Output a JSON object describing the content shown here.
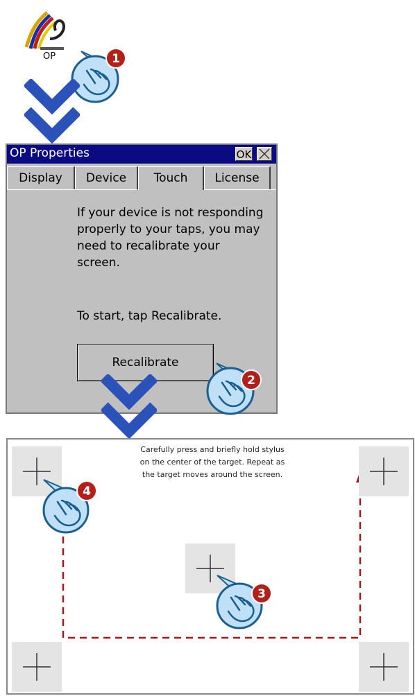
{
  "desktop": {
    "icon_name": "op-properties-icon",
    "icon_label": "OP"
  },
  "dialog": {
    "title": "OP Properties",
    "ok_label": "OK",
    "tabs": [
      {
        "label": "Display",
        "active": false
      },
      {
        "label": "Device",
        "active": false
      },
      {
        "label": "Touch",
        "active": true
      },
      {
        "label": "License",
        "active": false
      }
    ],
    "touch": {
      "description": "If your device is not responding properly to your taps, you may need to recalibrate your screen.",
      "start_hint": "To start, tap Recalibrate.",
      "recalibrate_label": "Recalibrate"
    }
  },
  "calibration": {
    "instructions": "Carefully press and briefly hold stylus on the center of the target. Repeat as the target moves around the screen."
  },
  "steps": [
    {
      "number": "1"
    },
    {
      "number": "2"
    },
    {
      "number": "3"
    },
    {
      "number": "4"
    }
  ],
  "colors": {
    "title_bar": "#0a0a82",
    "chevron": "#2a52b8",
    "hand_fill": "#bfe0f6",
    "hand_outline": "#1a5f8e",
    "badge": "#b3201a",
    "path_arrow": "#a01818"
  }
}
